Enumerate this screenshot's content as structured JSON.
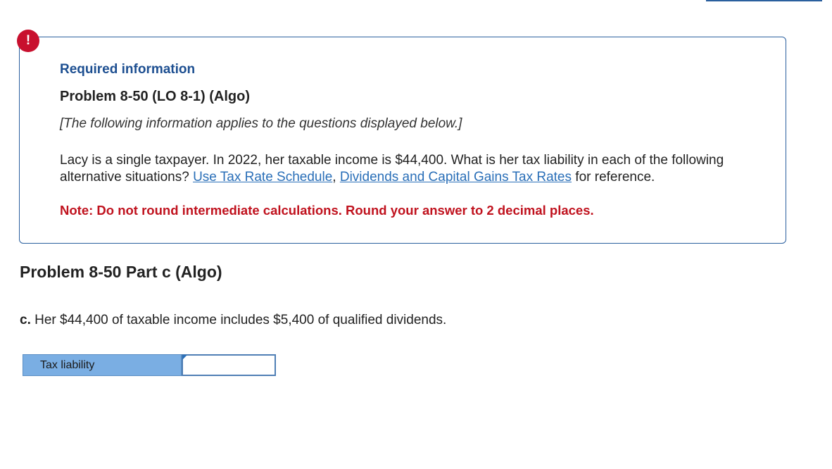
{
  "alert": {
    "symbol": "!"
  },
  "info": {
    "heading": "Required information",
    "problem_title": "Problem 8-50 (LO 8-1) (Algo)",
    "applies_note": "[The following information applies to the questions displayed below.]",
    "body_text": "Lacy is a single taxpayer. In 2022, her taxable income is $44,400. What is her tax liability in each of the following alternative situations?",
    "link_tax_rate_schedule": "Use Tax Rate Schedule",
    "link_separator": ",",
    "link_dividends_rates": "Dividends and Capital Gains Tax Rates",
    "body_suffix": "for reference.",
    "note": "Note: Do not round intermediate calculations. Round your answer to 2 decimal places."
  },
  "part": {
    "title": "Problem 8-50 Part c (Algo)",
    "question_letter": "c.",
    "question_text": "Her $44,400 of taxable income includes $5,400 of qualified dividends."
  },
  "answer": {
    "label": "Tax liability",
    "value": "",
    "placeholder": ""
  }
}
